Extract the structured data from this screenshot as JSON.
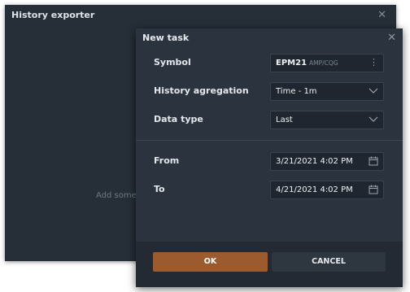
{
  "background_window": {
    "title": "History exporter",
    "empty_text": "Add some"
  },
  "modal": {
    "title": "New task",
    "symbol": {
      "label": "Symbol",
      "value": "EPM21",
      "source": "AMP/CQG"
    },
    "aggregation": {
      "label": "History agregation",
      "value": "Time - 1m"
    },
    "data_type": {
      "label": "Data type",
      "value": "Last"
    },
    "from": {
      "label": "From",
      "value": "3/21/2021 4:02 PM"
    },
    "to": {
      "label": "To",
      "value": "4/21/2021 4:02 PM"
    },
    "ok_label": "OK",
    "cancel_label": "CANCEL"
  },
  "icons": {
    "close": "close-icon",
    "more": "more-vertical-icon",
    "dropdown": "chevron-down-icon",
    "calendar": "calendar-icon"
  },
  "colors": {
    "accent": "#9c5a2f",
    "window_bg": "#262e38",
    "modal_bg": "#2b333e"
  }
}
